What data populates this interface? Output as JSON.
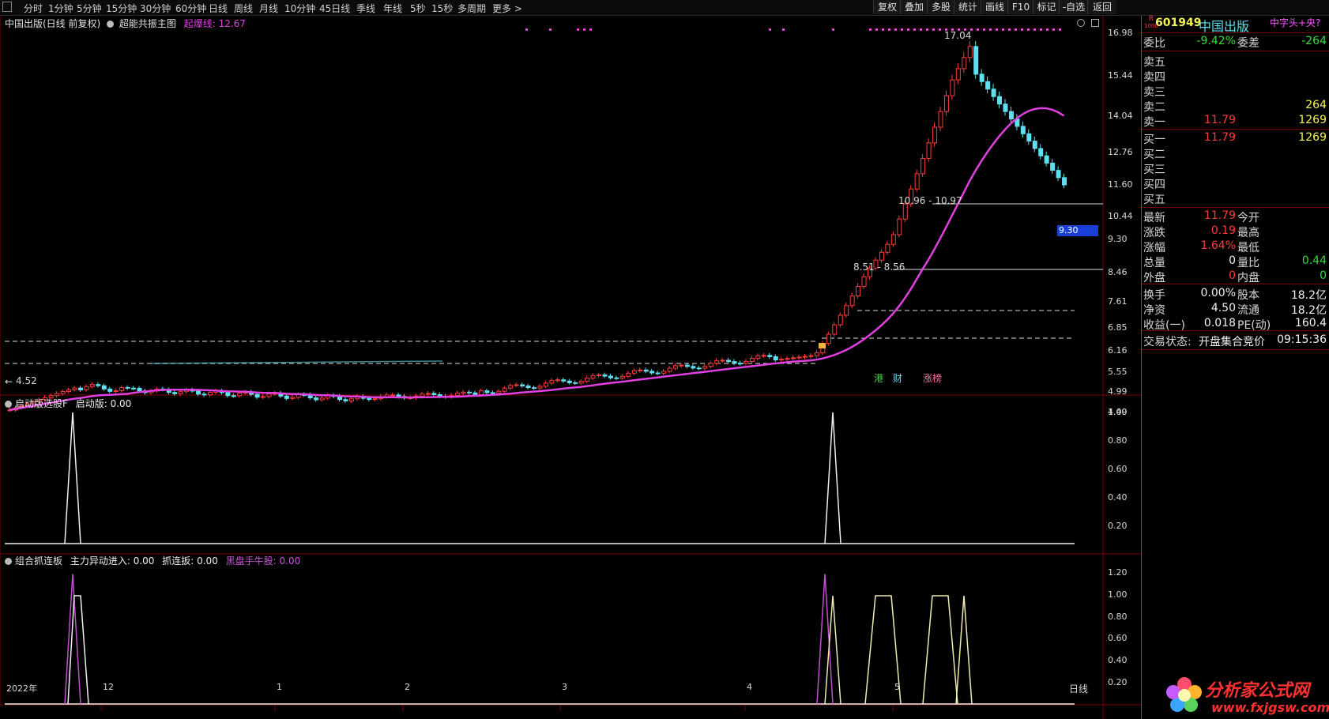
{
  "toolbar": {
    "periods": [
      "分时",
      "1分钟",
      "5分钟",
      "15分钟",
      "30分钟",
      "60分钟",
      "日线",
      "周线",
      "月线",
      "10分钟",
      "45日线",
      "季线",
      "年线",
      "5秒",
      "15秒",
      "多周期",
      "更多 >"
    ],
    "buttons": [
      "复权",
      "叠加",
      "多股",
      "统计",
      "画线",
      "F10",
      "标记",
      "-自选",
      "返回"
    ]
  },
  "main_panel": {
    "stock_title": "中国出版(日线 前复权)",
    "indicator_name": "超能共振主图",
    "indicator_series": "起爆线",
    "indicator_value": "12.67",
    "y_ticks": [
      "16.98",
      "15.44",
      "14.04",
      "12.76",
      "11.60",
      "10.44",
      "9.30",
      "8.46",
      "7.61",
      "6.85",
      "6.16",
      "5.55",
      "4.99",
      "4.49"
    ],
    "current_price_tag": "9.30",
    "annotations": {
      "high": "17.04",
      "low": "4.52",
      "zone1": "10.96 - 10.97",
      "zone2": "8.51 - 8.56"
    },
    "tags": [
      "港",
      "财",
      "涨榜"
    ],
    "last_price_value": 11.79
  },
  "panel2": {
    "title": "启动版选股F",
    "series_label": "启动版: 0.00",
    "y_ticks": [
      "1.00",
      "0.80",
      "0.60",
      "0.40",
      "0.20"
    ]
  },
  "panel3": {
    "title": "组合抓连板",
    "series1": "主力异动进入: 0.00",
    "series2": "抓连扳: 0.00",
    "series3": "黑盘手牛股: 0.00",
    "y_ticks": [
      "1.20",
      "1.00",
      "0.80",
      "0.60",
      "0.40",
      "0.20"
    ]
  },
  "x_axis": {
    "labels": [
      "2022年",
      "12",
      "1",
      "2",
      "3",
      "4",
      "5"
    ],
    "period_label": "日线"
  },
  "quote": {
    "code": "601949",
    "name": "中国出版",
    "badge_top": "R",
    "badge_bottom": "1000",
    "tag": "中字头+央?",
    "weibi_label": "委比",
    "weibi": "-9.42%",
    "weicha_label": "委差",
    "weicha": "-264",
    "sells": [
      {
        "label": "卖五",
        "price": "",
        "vol": ""
      },
      {
        "label": "卖四",
        "price": "",
        "vol": ""
      },
      {
        "label": "卖三",
        "price": "",
        "vol": ""
      },
      {
        "label": "卖二",
        "price": "",
        "vol": "264"
      },
      {
        "label": "卖一",
        "price": "11.79",
        "vol": "1269"
      }
    ],
    "buys": [
      {
        "label": "买一",
        "price": "11.79",
        "vol": "1269"
      },
      {
        "label": "买二",
        "price": "",
        "vol": ""
      },
      {
        "label": "买三",
        "price": "",
        "vol": ""
      },
      {
        "label": "买四",
        "price": "",
        "vol": ""
      },
      {
        "label": "买五",
        "price": "",
        "vol": ""
      }
    ],
    "stats": [
      {
        "l1": "最新",
        "v1": "11.79",
        "c1": "red",
        "l2": "今开",
        "v2": "",
        "c2": "white"
      },
      {
        "l1": "涨跌",
        "v1": "0.19",
        "c1": "red",
        "l2": "最高",
        "v2": "",
        "c2": "white"
      },
      {
        "l1": "涨幅",
        "v1": "1.64%",
        "c1": "red",
        "l2": "最低",
        "v2": "",
        "c2": "white"
      },
      {
        "l1": "总量",
        "v1": "0",
        "c1": "white",
        "l2": "量比",
        "v2": "0.44",
        "c2": "green"
      },
      {
        "l1": "外盘",
        "v1": "0",
        "c1": "red",
        "l2": "内盘",
        "v2": "0",
        "c2": "green"
      }
    ],
    "fundamentals": [
      {
        "l1": "换手",
        "v1": "0.00%",
        "l2": "股本",
        "v2": "18.2亿"
      },
      {
        "l1": "净资",
        "v1": "4.50",
        "l2": "流通",
        "v2": "18.2亿"
      },
      {
        "l1": "收益(一)",
        "v1": "0.018",
        "l2": "PE(动)",
        "v2": "160.4"
      }
    ],
    "status_label": "交易状态:",
    "status_value": "开盘集合竞价",
    "status_time": "09:15:36"
  },
  "watermark": {
    "text": "分析家公式网",
    "url": "www.fxjgsw.com"
  },
  "colors": {
    "up": "#ff3b3b",
    "down": "#5ee0f0",
    "ma_line": "#e040e0",
    "signal_white": "#f0f0f0",
    "signal_purple": "#c050d0",
    "signal_cream": "#f0eab0"
  }
}
